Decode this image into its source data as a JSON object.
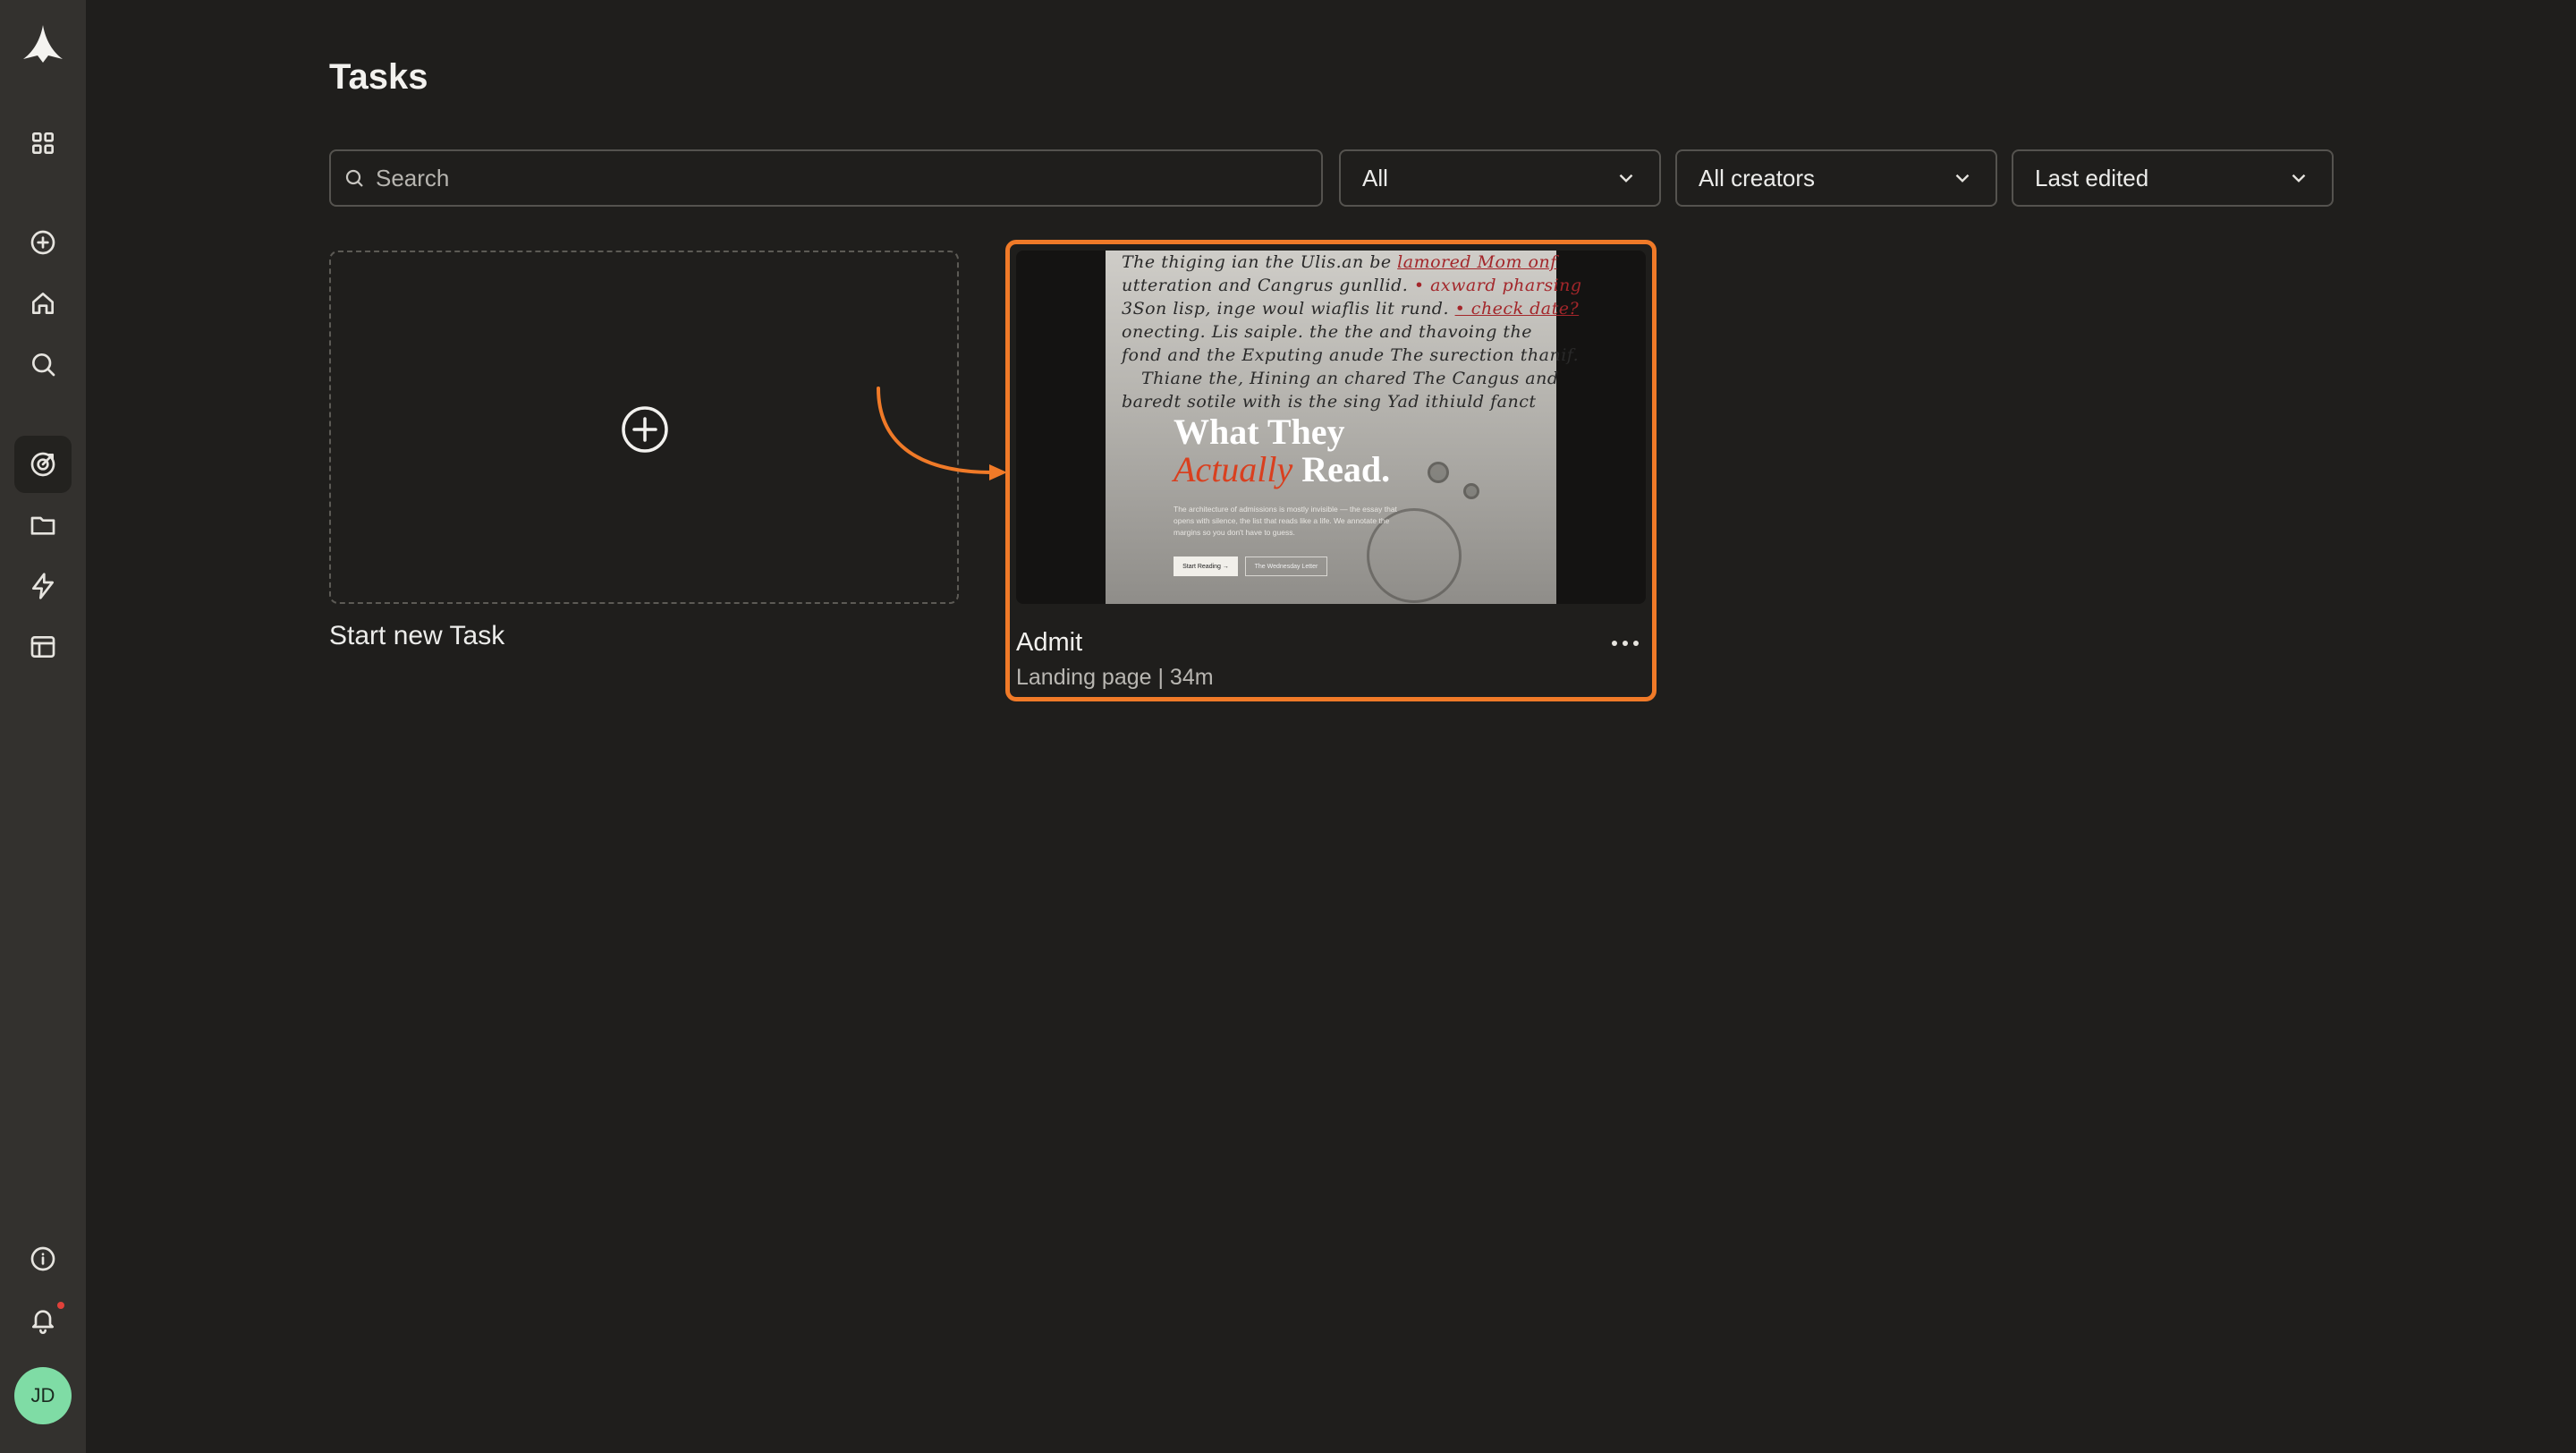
{
  "page": {
    "title": "Tasks"
  },
  "search": {
    "placeholder": "Search"
  },
  "filters": {
    "type": "All",
    "creators": "All creators",
    "sort": "Last edited"
  },
  "new_task": {
    "label": "Start new Task"
  },
  "task": {
    "name": "Admit",
    "meta": "Landing page | 34m",
    "thumbnail": {
      "handwriting": [
        "The thiging ian the  Ulis.an be",
        "lamored Mom onf",
        "utteration and  Cangrus gunllid.",
        "• axward pharsing",
        "3Son lisp, inge woul wiaflis lit rund.",
        "• check date?",
        "onecting.  Lis saiple.  the  the and  thavoing  the",
        "fond and  the  Exputing anude  The surection  thanif.",
        "Thiane the,  Hining  an chared  The Cangus  and",
        "baredt sotile with is the sing  Yad  ithiuld fanct"
      ],
      "headline_1": "What They",
      "headline_accent": "Actually",
      "headline_2": " Read.",
      "description": "The architecture of admissions is mostly invisible — the essay that opens with silence, the list that reads like a life. We annotate the margins so you don't have to guess.",
      "button_primary": "Start Reading →",
      "button_secondary": "The Wednesday Letter"
    }
  },
  "user": {
    "initials": "JD"
  },
  "colors": {
    "background": "#1f1e1c",
    "sidebar": "#33312e",
    "accent": "#f07a28",
    "avatar": "#7fdca5",
    "notification": "#e0413a"
  }
}
